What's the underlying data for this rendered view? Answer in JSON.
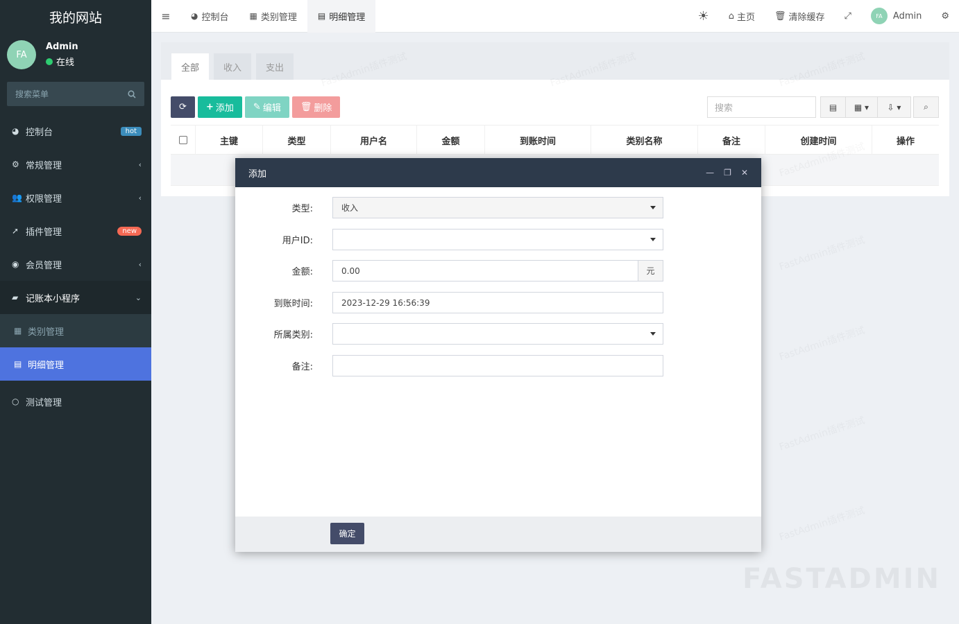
{
  "sidebar": {
    "brand": "我的网站",
    "user": {
      "avatar": "FA",
      "name": "Admin",
      "status": "在线"
    },
    "search_placeholder": "搜索菜单",
    "items": [
      {
        "label": "控制台",
        "icon": "dashboard-icon",
        "badge": "hot"
      },
      {
        "label": "常规管理",
        "icon": "cogs-icon"
      },
      {
        "label": "权限管理",
        "icon": "users-icon"
      },
      {
        "label": "插件管理",
        "icon": "rocket-icon",
        "badge": "new"
      },
      {
        "label": "会员管理",
        "icon": "user-circle-icon"
      },
      {
        "label": "记账本小程序",
        "icon": "book-icon"
      }
    ],
    "subitems": [
      {
        "label": "类别管理",
        "icon": "grid-icon"
      },
      {
        "label": "明细管理",
        "icon": "list-icon"
      }
    ],
    "last_item": {
      "label": "测试管理",
      "icon": "circle-icon"
    }
  },
  "topnav": {
    "tabs": [
      {
        "label": "控制台",
        "icon": "dashboard-icon"
      },
      {
        "label": "类别管理",
        "icon": "grid-icon"
      },
      {
        "label": "明细管理",
        "icon": "list-icon"
      }
    ],
    "home": "主页",
    "clear_cache": "清除缓存",
    "user_avatar": "FA",
    "user_name": "Admin"
  },
  "panel": {
    "tabs": [
      "全部",
      "收入",
      "支出"
    ],
    "buttons": {
      "add": "添加",
      "edit": "编辑",
      "delete": "删除"
    },
    "search_placeholder": "搜索",
    "columns": [
      "主键",
      "类型",
      "用户名",
      "金额",
      "到账时间",
      "类别名称",
      "备注",
      "创建时间",
      "操作"
    ]
  },
  "modal": {
    "title": "添加",
    "fields": {
      "type_label": "类型:",
      "type_value": "收入",
      "userid_label": "用户ID:",
      "userid_value": "",
      "amount_label": "金额:",
      "amount_value": "0.00",
      "amount_unit": "元",
      "time_label": "到账时间:",
      "time_value": "2023-12-29 16:56:39",
      "category_label": "所属类别:",
      "category_value": "",
      "remark_label": "备注:",
      "remark_value": ""
    },
    "confirm": "确定"
  },
  "watermark": "FastAdmin插件测试",
  "footer_logo": "FASTADMIN"
}
